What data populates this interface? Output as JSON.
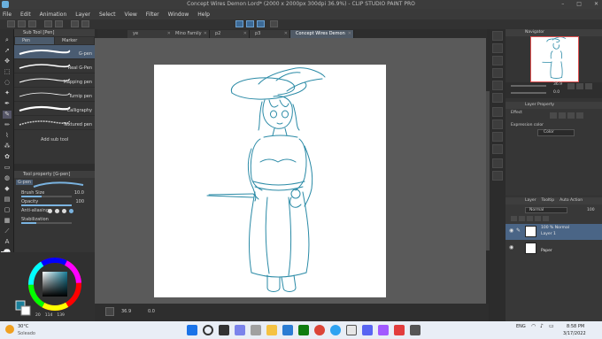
{
  "window": {
    "title": "Concept Wires Demon Lord* (2000 x 2000px 300dpi 36.9%) - CLIP STUDIO PAINT PRO",
    "controls": [
      "–",
      "□",
      "✕"
    ]
  },
  "menu": {
    "items": [
      "File",
      "Edit",
      "Animation",
      "Layer",
      "Select",
      "View",
      "Filter",
      "Window",
      "Help"
    ]
  },
  "tabs": [
    {
      "label": "ye",
      "active": false
    },
    {
      "label": "Mino Family",
      "active": false
    },
    {
      "label": "p2",
      "active": false
    },
    {
      "label": "p3",
      "active": false
    },
    {
      "label": "Concept Wires Demon Lord*",
      "active": true
    }
  ],
  "subtool": {
    "header": "Sub Tool [Pen]",
    "groups": [
      "Pen",
      "Marker"
    ],
    "brushes": [
      {
        "label": "G-pen",
        "active": true
      },
      {
        "label": "Real G-Pen",
        "active": false
      },
      {
        "label": "Mapping pen",
        "active": false
      },
      {
        "label": "Turnip pen",
        "active": false
      },
      {
        "label": "Calligraphy",
        "active": false
      },
      {
        "label": "Textured pen",
        "active": false
      }
    ],
    "add_label": "Add sub tool"
  },
  "tool_property": {
    "header": "Tool property [G-pen]",
    "brush_name": "G-pen",
    "rows": [
      {
        "name": "Brush Size",
        "value": "10.0",
        "fill": 0.4
      },
      {
        "name": "Opacity",
        "value": "100",
        "fill": 1.0
      },
      {
        "name": "Anti-aliasing",
        "value": "",
        "fill": 0
      },
      {
        "name": "Stabilization",
        "value": "",
        "fill": 0.3
      }
    ]
  },
  "color": {
    "main": "#1a7f9a",
    "sub": "#ffffff",
    "readout": [
      "20",
      "114",
      "139"
    ]
  },
  "navigator": {
    "header": "Navigator",
    "zoom": "36.9",
    "angle": "0.0"
  },
  "layer_property": {
    "header": "Layer Property",
    "effect_label": "Effect",
    "expression_label": "Expression color",
    "expression_value": "Color"
  },
  "layers": {
    "tabs": [
      "Layer",
      "Tooltip",
      "Auto Action"
    ],
    "blend_mode": "Normal",
    "opacity": "100",
    "items": [
      {
        "line1": "100 % Normal",
        "line2": "Layer 1",
        "active": true
      },
      {
        "line1": "",
        "line2": "Paper",
        "active": false
      }
    ]
  },
  "taskbar": {
    "weather_temp": "30°C",
    "weather_desc": "Soleado",
    "lang": "ENG",
    "time": "8:58 PM",
    "date": "3/17/2022"
  },
  "canvas_footer": {
    "zoom": "36.9",
    "status": "0.0"
  }
}
